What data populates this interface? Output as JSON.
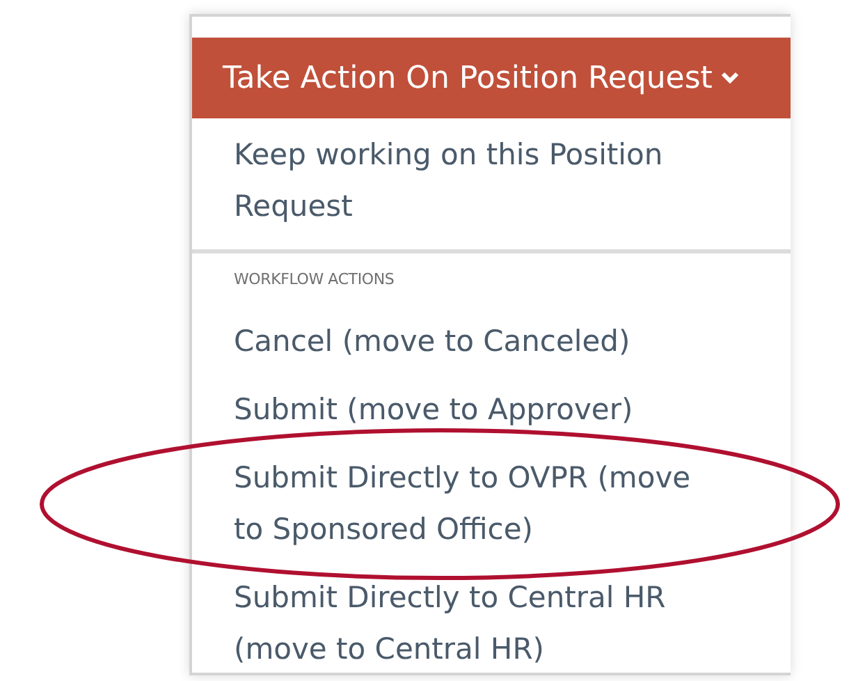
{
  "menu": {
    "title": "Take Action On Position Request",
    "items": [
      {
        "label": "Keep working on this Position Request"
      }
    ],
    "section_heading": "WORKFLOW ACTIONS",
    "workflow_actions": [
      {
        "label": "Cancel (move to Canceled)",
        "highlighted": false
      },
      {
        "label": "Submit (move to Approver)",
        "highlighted": false
      },
      {
        "label": "Submit Directly to OVPR (move to Sponsored Office)",
        "highlighted": true
      },
      {
        "label": "Submit Directly to Central HR (move to Central HR)",
        "highlighted": false
      }
    ]
  }
}
